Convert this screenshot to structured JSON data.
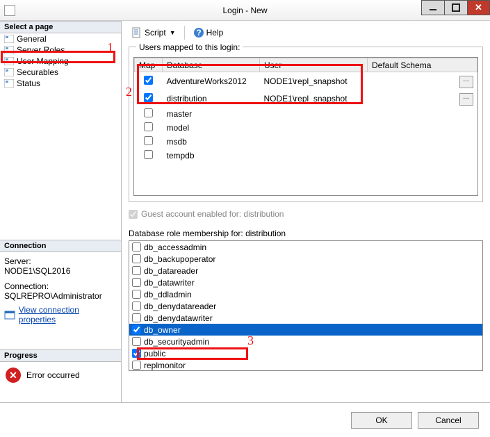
{
  "window": {
    "title": "Login - New"
  },
  "sidebar": {
    "header": "Select a page",
    "items": [
      {
        "label": "General"
      },
      {
        "label": "Server Roles"
      },
      {
        "label": "User Mapping"
      },
      {
        "label": "Securables"
      },
      {
        "label": "Status"
      }
    ]
  },
  "connection": {
    "header": "Connection",
    "serverLabel": "Server:",
    "serverValue": "NODE1\\SQL2016",
    "connLabel": "Connection:",
    "connValue": "SQLREPRO\\Administrator",
    "linkText": "View connection properties"
  },
  "progress": {
    "header": "Progress",
    "text": "Error occurred"
  },
  "toolbar": {
    "scriptLabel": "Script",
    "helpLabel": "Help"
  },
  "mapping": {
    "groupLabel": "Users mapped to this login:",
    "cols": {
      "map": "Map",
      "database": "Database",
      "user": "User",
      "schema": "Default Schema"
    },
    "rows": [
      {
        "checked": true,
        "database": "AdventureWorks2012",
        "user": "NODE1\\repl_snapshot",
        "schemaBtn": true
      },
      {
        "checked": true,
        "database": "distribution",
        "user": "NODE1\\repl_snapshot",
        "schemaBtn": true
      },
      {
        "checked": false,
        "database": "master",
        "user": "",
        "schemaBtn": false
      },
      {
        "checked": false,
        "database": "model",
        "user": "",
        "schemaBtn": false
      },
      {
        "checked": false,
        "database": "msdb",
        "user": "",
        "schemaBtn": false
      },
      {
        "checked": false,
        "database": "tempdb",
        "user": "",
        "schemaBtn": false
      }
    ]
  },
  "guest": {
    "label": "Guest account enabled for: distribution",
    "checked": true
  },
  "roles": {
    "label": "Database role membership for: distribution",
    "items": [
      {
        "label": "db_accessadmin",
        "checked": false,
        "selected": false
      },
      {
        "label": "db_backupoperator",
        "checked": false,
        "selected": false
      },
      {
        "label": "db_datareader",
        "checked": false,
        "selected": false
      },
      {
        "label": "db_datawriter",
        "checked": false,
        "selected": false
      },
      {
        "label": "db_ddladmin",
        "checked": false,
        "selected": false
      },
      {
        "label": "db_denydatareader",
        "checked": false,
        "selected": false
      },
      {
        "label": "db_denydatawriter",
        "checked": false,
        "selected": false
      },
      {
        "label": "db_owner",
        "checked": true,
        "selected": true
      },
      {
        "label": "db_securityadmin",
        "checked": false,
        "selected": false
      },
      {
        "label": "public",
        "checked": true,
        "selected": false
      },
      {
        "label": "replmonitor",
        "checked": false,
        "selected": false
      }
    ]
  },
  "buttons": {
    "ok": "OK",
    "cancel": "Cancel"
  },
  "annotations": {
    "a1": "1",
    "a2": "2",
    "a3": "3"
  }
}
